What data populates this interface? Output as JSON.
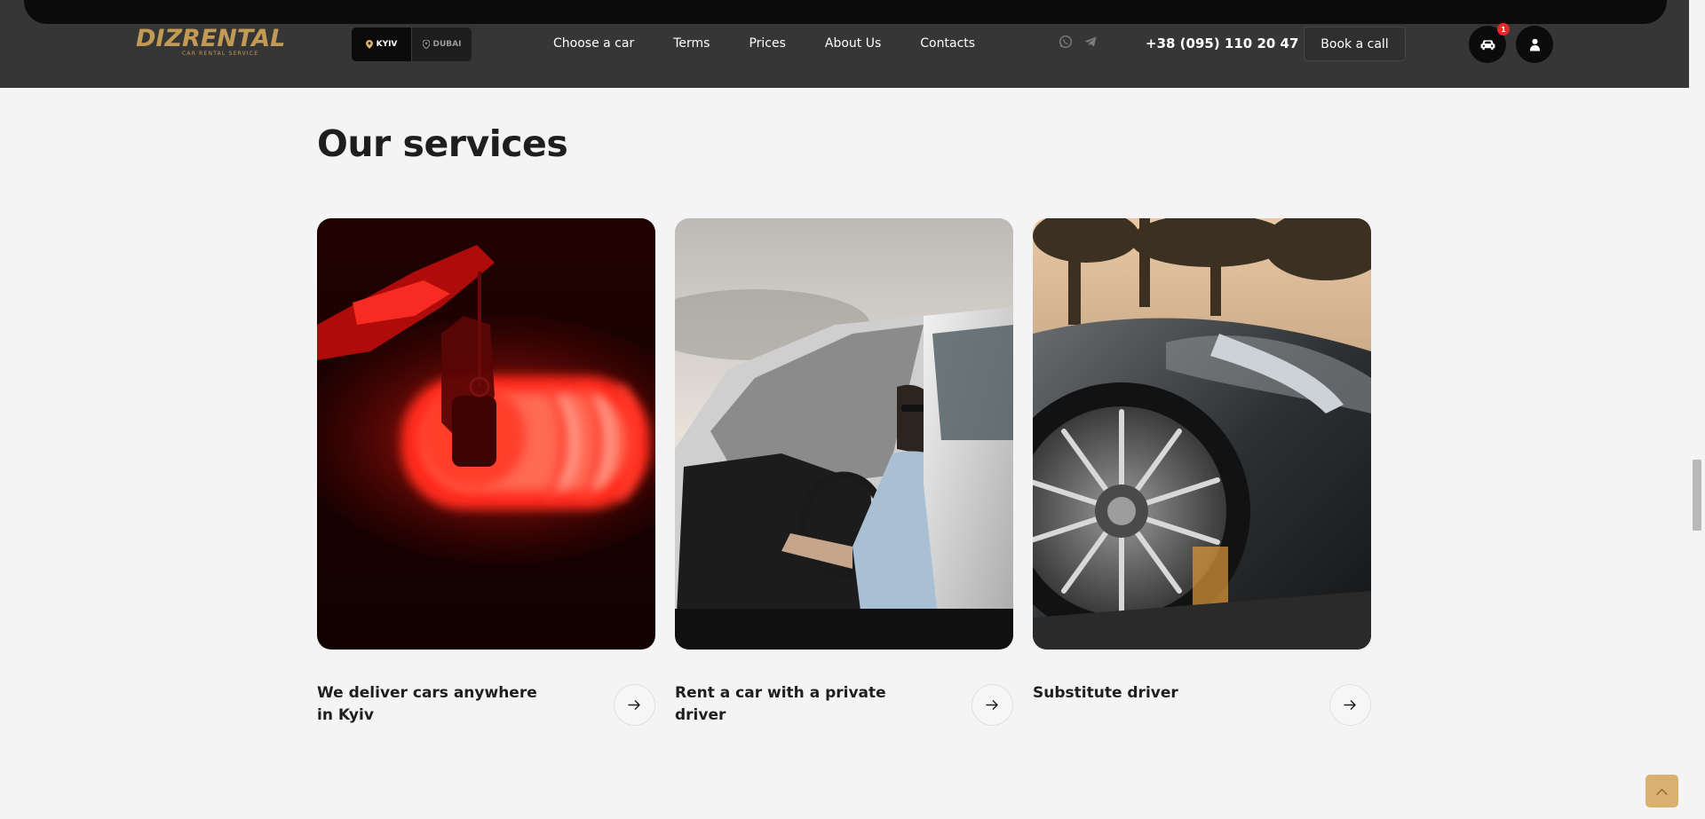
{
  "header": {
    "logo": {
      "name": "DIZRENTAL",
      "tagline": "CAR RENTAL SERVICE"
    },
    "cities": [
      {
        "label": "KYIV",
        "active": true
      },
      {
        "label": "DUBAI",
        "active": false
      }
    ],
    "nav": [
      "Choose a car",
      "Terms",
      "Prices",
      "About Us",
      "Contacts"
    ],
    "social_icons": [
      "whatsapp-icon",
      "telegram-icon"
    ],
    "phone": "+38 (095) 110 20 47",
    "book_button": "Book a call",
    "cart_badge": "1",
    "icons": {
      "cart": "car-icon",
      "account": "user-icon"
    }
  },
  "services": {
    "title": "Our services",
    "cards": [
      {
        "title": "We deliver cars anywhere in Kyiv",
        "image": "glowing-red-car-key-photo"
      },
      {
        "title": "Rent a car with a private driver",
        "image": "man-in-car-driver-seat-photo"
      },
      {
        "title": "Substitute driver",
        "image": "black-car-wheel-photo"
      }
    ]
  },
  "colors": {
    "header_bg": "#363636",
    "page_bg": "#f4f4f4",
    "brand_gold": "#c29a54",
    "badge_red": "#e32a2a",
    "to_top_bg": "#d9b070"
  }
}
